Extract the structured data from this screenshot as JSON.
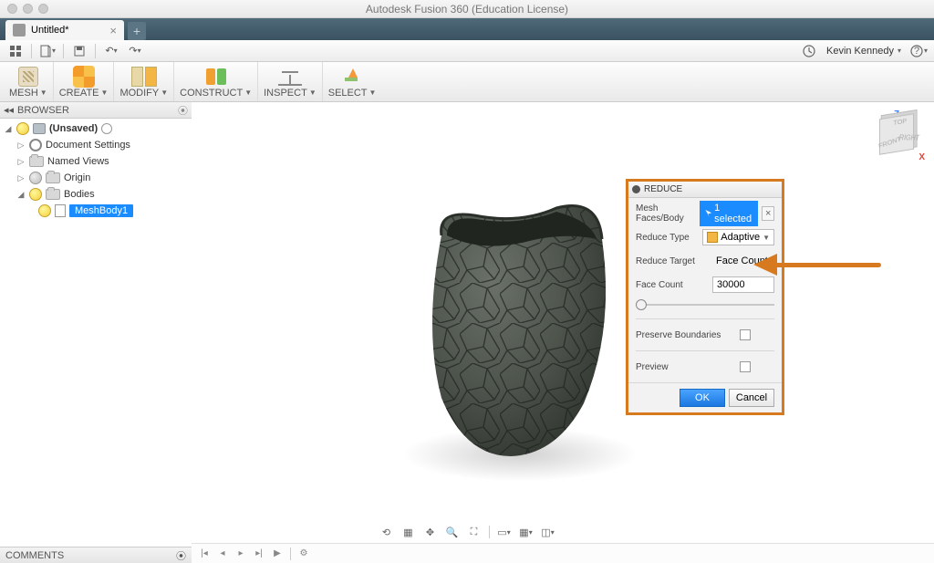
{
  "window": {
    "title": "Autodesk Fusion 360 (Education License)"
  },
  "tab": {
    "name": "Untitled*"
  },
  "user": {
    "name": "Kevin Kennedy"
  },
  "ribbon": {
    "workspace": "MESH",
    "groups": {
      "create": "CREATE",
      "modify": "MODIFY",
      "construct": "CONSTRUCT",
      "inspect": "INSPECT",
      "select": "SELECT"
    }
  },
  "browser": {
    "title": "BROWSER",
    "root": "(Unsaved)",
    "items": {
      "doc_settings": "Document Settings",
      "named_views": "Named Views",
      "origin": "Origin",
      "bodies": "Bodies",
      "meshbody": "MeshBody1"
    }
  },
  "viewcube": {
    "top": "TOP",
    "front": "FRONT",
    "right": "RIGHT",
    "z": "Z",
    "x": "X"
  },
  "panel": {
    "title": "REDUCE",
    "mesh_faces_label": "Mesh Faces/Body",
    "mesh_faces_selection": "1 selected",
    "reduce_type_label": "Reduce Type",
    "reduce_type_value": "Adaptive",
    "reduce_target_label": "Reduce Target",
    "reduce_target_value": "Face Count",
    "face_count_label": "Face Count",
    "face_count_value": "30000",
    "preserve_label": "Preserve Boundaries",
    "preview_label": "Preview",
    "ok": "OK",
    "cancel": "Cancel"
  },
  "comments": {
    "title": "COMMENTS"
  }
}
